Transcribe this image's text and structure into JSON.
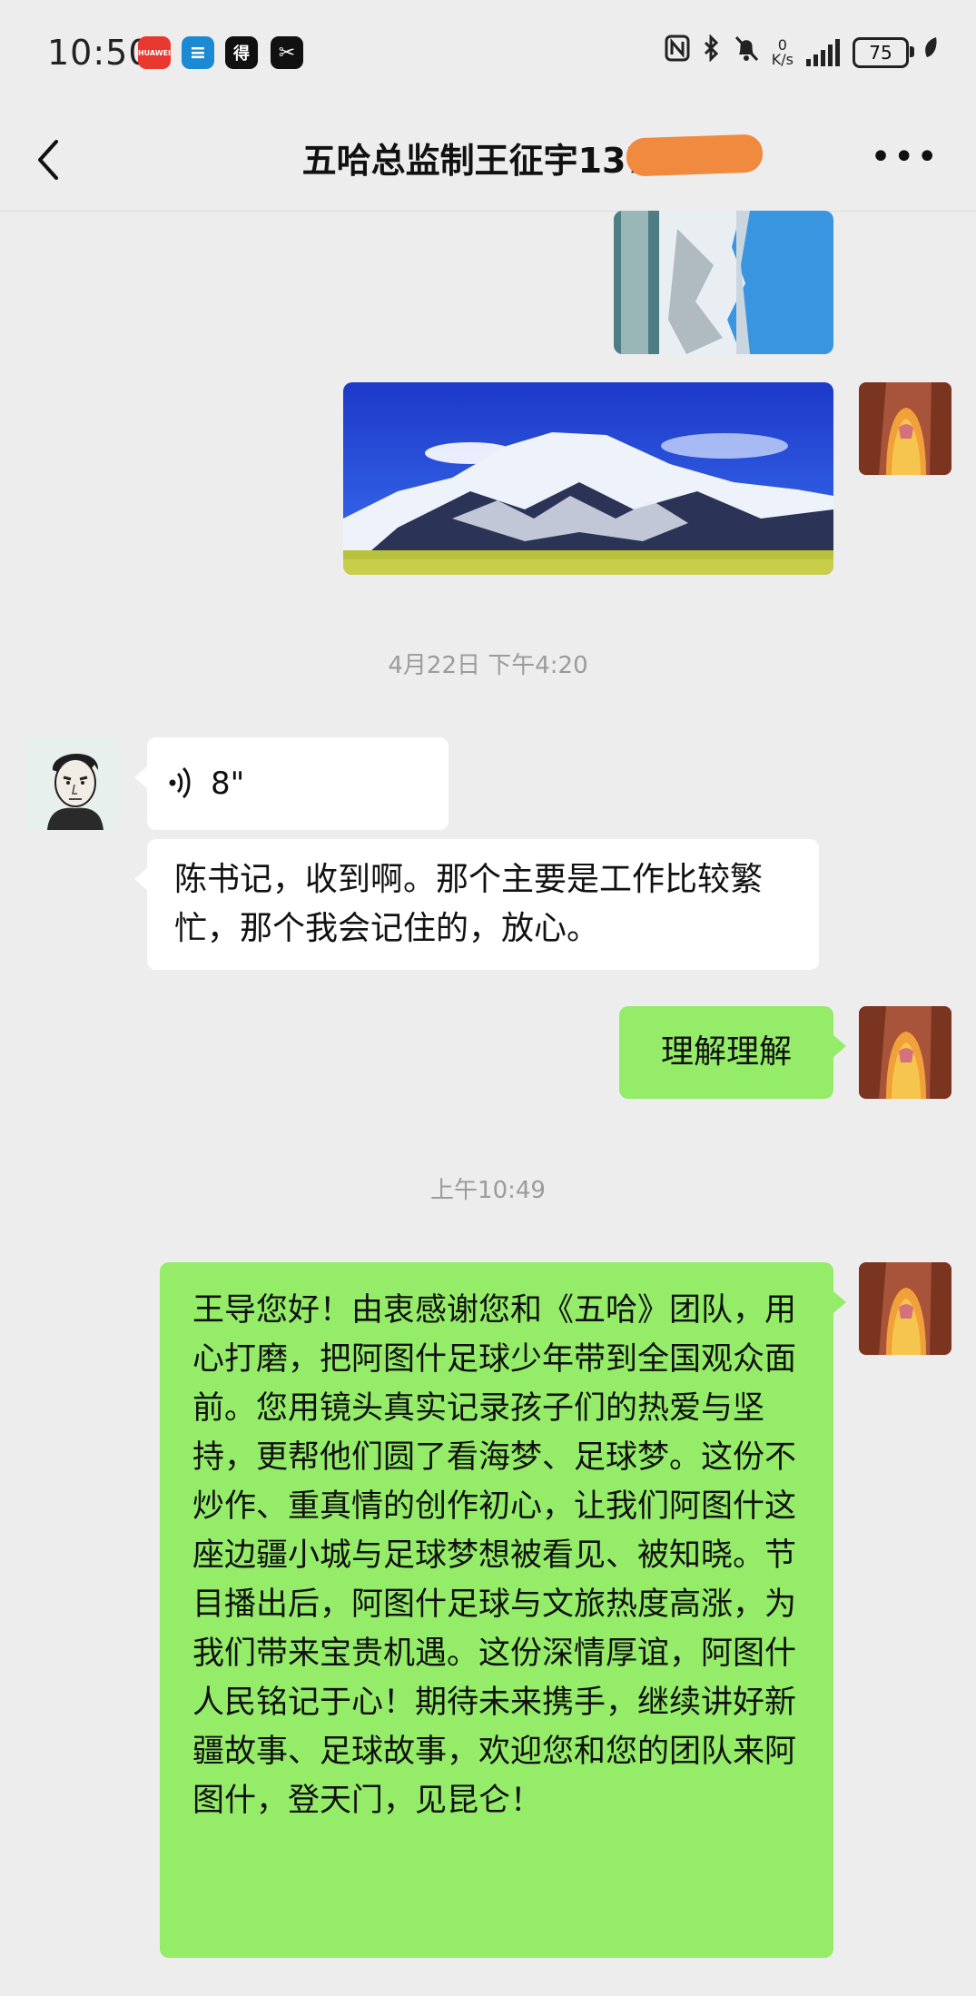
{
  "status_bar": {
    "time": "10:50",
    "apps": [
      {
        "name": "huawei-app-icon",
        "label": "HUAWEI",
        "color": "#e8382f"
      },
      {
        "name": "list-app-icon",
        "label": "≡",
        "color": "#1b8ad3"
      },
      {
        "name": "news-app-icon",
        "label": "得",
        "color": "#111111"
      },
      {
        "name": "capcut-app-icon",
        "label": "✂",
        "color": "#111111"
      }
    ],
    "net_speed_value": "0",
    "net_speed_unit": "K/s",
    "battery": "75"
  },
  "nav": {
    "title": "五哈总监制王征宇1375",
    "back_icon": "chevron-left-icon",
    "more_label": "•••"
  },
  "chat": {
    "timestamp_1": "4月22日 下午4:20",
    "voice_duration": "8\"",
    "incoming_text": "陈书记，收到啊。那个主要是工作比较繁忙，那个我会记住的，放心。",
    "reply_short": "理解理解",
    "timestamp_2": "上午10:49",
    "long_message": "王导您好！由衷感谢您和《五哈》团队，用心打磨，把阿图什足球少年带到全国观众面前。您用镜头真实记录孩子们的热爱与坚持，更帮他们圆了看海梦、足球梦。这份不炒作、重真情的创作初心，让我们阿图什这座边疆小城与足球梦想被看见、被知晓。节目播出后，阿图什足球与文旅热度高涨，为我们带来宝贵机遇。这份深情厚谊，阿图什人民铭记于心！期待未来携手，继续讲好新疆故事、足球故事，欢迎您和您的团队来阿图什，登天门，见昆仑！"
  },
  "colors": {
    "background": "#ededed",
    "out_bubble": "#95ec69",
    "in_bubble": "#ffffff",
    "timestamp": "#9b9b9b"
  }
}
